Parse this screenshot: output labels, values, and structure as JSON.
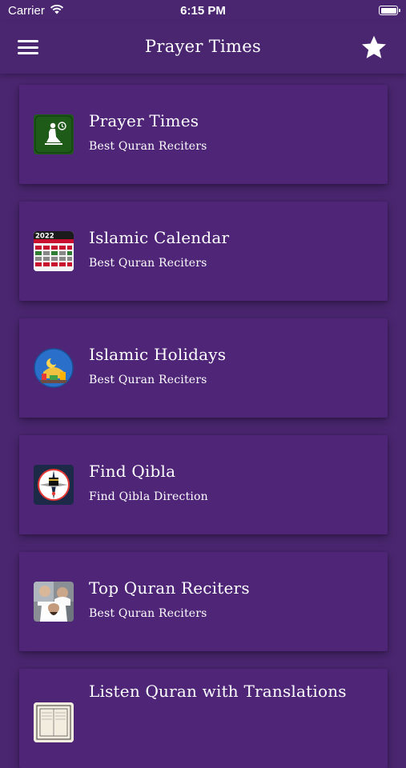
{
  "status_bar": {
    "carrier": "Carrier",
    "time": "6:15 PM"
  },
  "nav": {
    "title": "Prayer Times",
    "menu_icon": "hamburger-menu-icon",
    "favorite_icon": "star-icon"
  },
  "colors": {
    "background": "#4a2670",
    "card": "#4f2578",
    "text": "#ffffff"
  },
  "items": [
    {
      "title": "Prayer Times",
      "subtitle": "Best Quran Reciters",
      "icon": "prayer-times-icon"
    },
    {
      "title": "Islamic Calendar",
      "subtitle": "Best Quran Reciters",
      "icon": "islamic-calendar-icon",
      "icon_text": "2022"
    },
    {
      "title": "Islamic Holidays",
      "subtitle": "Best Quran Reciters",
      "icon": "islamic-holidays-icon"
    },
    {
      "title": "Find Qibla",
      "subtitle": "Find Qibla Direction",
      "icon": "qibla-compass-icon"
    },
    {
      "title": "Top Quran Reciters",
      "subtitle": "Best Quran Reciters",
      "icon": "quran-reciter-icon"
    },
    {
      "title": "Listen Quran with Translations",
      "subtitle": "",
      "icon": "quran-book-icon"
    }
  ]
}
